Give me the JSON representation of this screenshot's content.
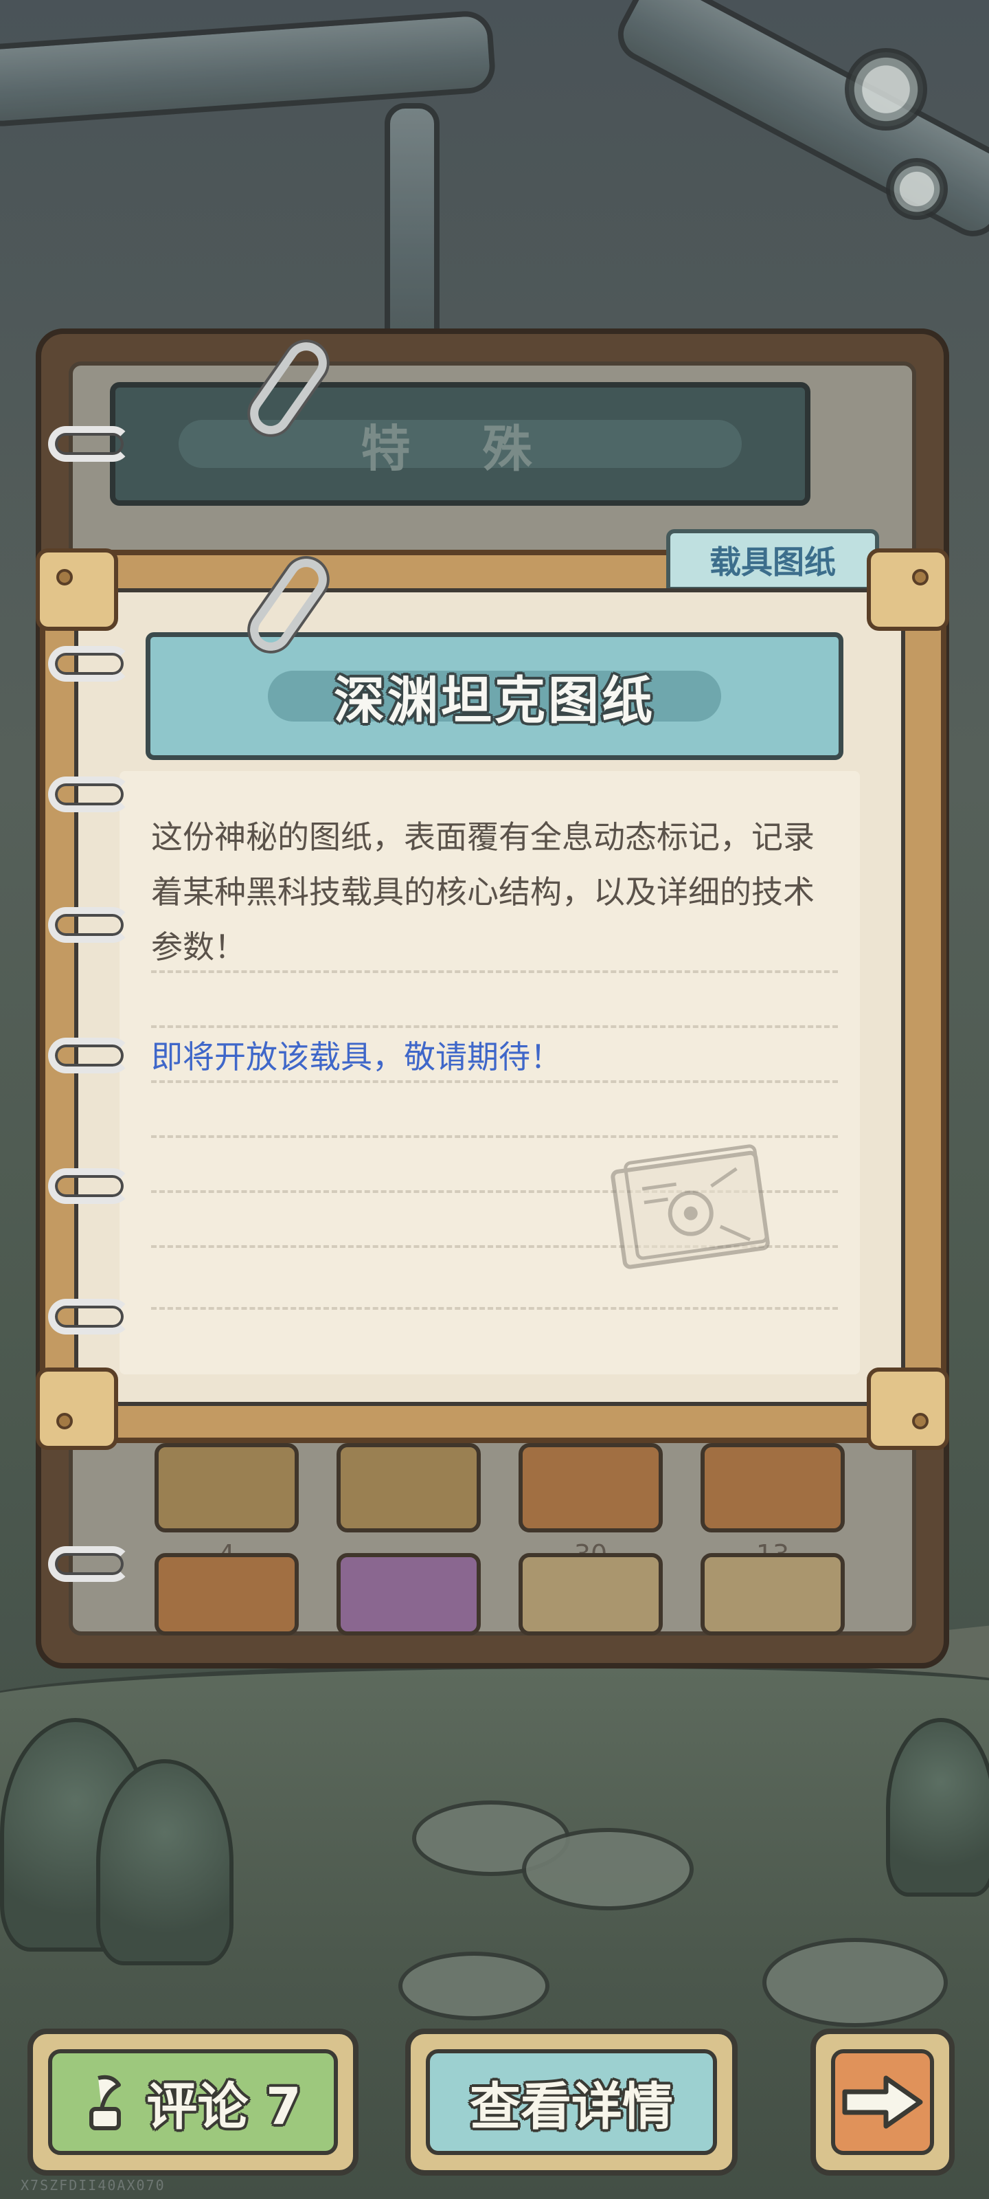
{
  "background": {
    "watermark": "X7SZFDII40AX070"
  },
  "back_book": {
    "header": "特 殊",
    "slot_counts": [
      "4",
      "",
      "30",
      "13"
    ]
  },
  "card": {
    "tab_label": "载具图纸",
    "title": "深渊坦克图纸",
    "description": "这份神秘的图纸，表面覆有全息动态标记，记录着某种黑科技载具的核心结构，以及详细的技术参数！",
    "notice": "即将开放该载具，敬请期待！",
    "notice_color": "#3f67c9"
  },
  "buttons": {
    "comment": {
      "label": "评论 7",
      "icon": "quill-icon"
    },
    "detail": {
      "label": "查看详情"
    },
    "next": {
      "icon": "arrow-right-icon"
    }
  },
  "colors": {
    "title_banner": "#8fc6cb",
    "comment_button": "#9dc87d",
    "detail_button": "#9cd0d0",
    "next_button": "#e0925a"
  }
}
